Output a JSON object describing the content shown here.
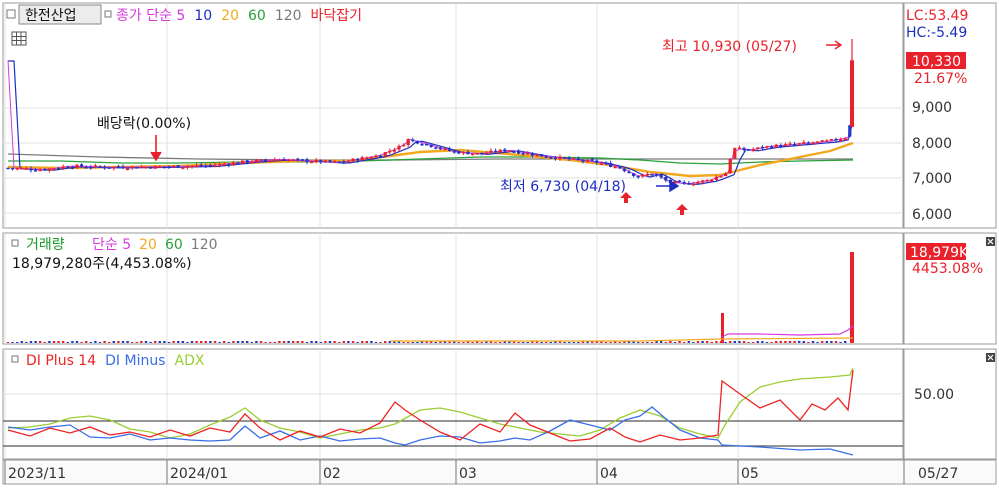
{
  "colors": {
    "up": "#e8212b",
    "down": "#2037c8",
    "ma5": "#d63adf",
    "ma10": "#1d2fc0",
    "ma20": "#f2a81e",
    "ma60": "#29a03a",
    "ma120": "#7a7a7a",
    "plus_di": "#ee2222",
    "minus_di": "#3a6ee8",
    "adx": "#9acd32",
    "grid": "#e1e1e1",
    "axis_text": "#333333"
  },
  "price_panel": {
    "name": "한전산업",
    "legend": [
      {
        "text": "종가 단순 5",
        "color": "#d63adf"
      },
      {
        "text": "10",
        "color": "#1d2fc0"
      },
      {
        "text": "20",
        "color": "#f2a81e"
      },
      {
        "text": "60",
        "color": "#29a03a"
      },
      {
        "text": "120",
        "color": "#7a7a7a"
      },
      {
        "text": "바닥잡기",
        "color": "#e8212b"
      }
    ],
    "lc_label": "LC:53.49",
    "hc_label": "HC:-5.49",
    "high_label": "최고 10,930 (05/27)",
    "low_label": "최저 6,730 (04/18)",
    "dividend_label": "배당락(0.00%)",
    "current_price": "10,330",
    "current_change": "21.67%",
    "y_ticks": [
      "9,000",
      "8,000",
      "7,000",
      "6,000"
    ]
  },
  "volume_panel": {
    "title": "거래량",
    "legend": [
      {
        "text": "단순 5",
        "color": "#d63adf"
      },
      {
        "text": "20",
        "color": "#f2a81e"
      },
      {
        "text": "60",
        "color": "#29a03a"
      },
      {
        "text": "120",
        "color": "#7a7a7a"
      }
    ],
    "info": "18,979,280주(4,453.08%)",
    "badge_value": "18,979K",
    "badge_pct": "4453.08%"
  },
  "di_panel": {
    "legend": [
      {
        "text": "DI Plus 14",
        "color": "#ee2222"
      },
      {
        "text": "DI Minus",
        "color": "#3a6ee8"
      },
      {
        "text": "ADX",
        "color": "#9acd32"
      }
    ],
    "y_tick": "50.00"
  },
  "x_axis": {
    "labels": [
      "2023/11",
      "2024/01",
      "02",
      "03",
      "04",
      "05",
      "05/27"
    ]
  },
  "chart_data": {
    "type": "line",
    "title": "한전산업",
    "x_axis_dates": [
      "2023/11",
      "2024/01",
      "02",
      "03",
      "04",
      "05",
      "05/27"
    ],
    "price_axis": {
      "ylim": [
        5800,
        10800
      ],
      "ticks": [
        6000,
        7000,
        8000,
        9000
      ]
    },
    "close_approx": [
      {
        "x": "2023/11",
        "y": 7300
      },
      {
        "x": "2024/01",
        "y": 7350
      },
      {
        "x": "02",
        "y": 7450
      },
      {
        "x": "03",
        "y": 7950
      },
      {
        "x": "04",
        "y": 7250
      },
      {
        "x": "04/18",
        "y": 6730
      },
      {
        "x": "05",
        "y": 7200
      },
      {
        "x": "05/27",
        "y": 10330
      }
    ],
    "high": {
      "x": "05/27",
      "y": 10930
    },
    "low": {
      "x": "04/18",
      "y": 6730
    },
    "volume": {
      "last": 18979280,
      "last_pct": 4453.08
    },
    "di_axis": {
      "ticks": [
        50
      ]
    },
    "series": [
      {
        "name": "DI Plus 14",
        "last": 68
      },
      {
        "name": "DI Minus",
        "last": 4
      },
      {
        "name": "ADX",
        "last": 66
      }
    ]
  }
}
